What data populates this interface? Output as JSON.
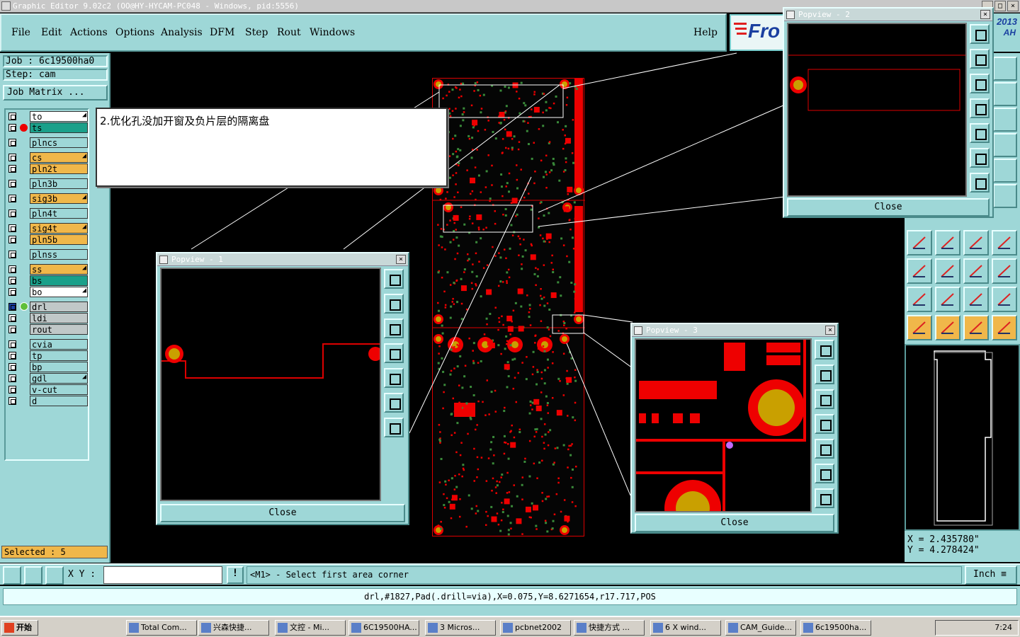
{
  "window": {
    "title": "Graphic Editor 9.02c2 (OO@HY-HYCAM-PC048 - Windows, pid:5556)"
  },
  "menu": {
    "items": [
      "File",
      "Edit",
      "Actions",
      "Options",
      "Analysis",
      "DFM",
      "Step",
      "Rout",
      "Windows"
    ],
    "help": "Help"
  },
  "logo": {
    "text": "Fro"
  },
  "corner": {
    "year": "2013",
    "sub": "AH"
  },
  "job": {
    "job_label": "Job : 6c19500ha0",
    "step_label": "Step: cam",
    "matrix_button": "Job Matrix ..."
  },
  "layers": [
    {
      "name": "to",
      "color": "#ffffff",
      "marker": true
    },
    {
      "name": "ts",
      "color": "#1aa08a",
      "dot": true
    },
    {
      "name": "plncs",
      "color": "#9ed7d7"
    },
    {
      "name": "cs",
      "color": "#f0b74a",
      "marker": true
    },
    {
      "name": "pln2t",
      "color": "#f0b74a"
    },
    {
      "name": "pln3b",
      "color": "#9ed7d7"
    },
    {
      "name": "sig3b",
      "color": "#f0b74a",
      "marker": true
    },
    {
      "name": "pln4t",
      "color": "#9ed7d7"
    },
    {
      "name": "sig4t",
      "color": "#f0b74a",
      "marker": true
    },
    {
      "name": "pln5b",
      "color": "#f0b74a"
    },
    {
      "name": "plnss",
      "color": "#9ed7d7"
    },
    {
      "name": "ss",
      "color": "#f0b74a",
      "marker": true
    },
    {
      "name": "bs",
      "color": "#1aa08a"
    },
    {
      "name": "bo",
      "color": "#ffffff",
      "marker": true
    },
    {
      "name": "drl",
      "color": "#c0c8c8",
      "active": true
    },
    {
      "name": "ldi",
      "color": "#c0c8c8"
    },
    {
      "name": "rout",
      "color": "#c0c8c8"
    },
    {
      "name": "cvia",
      "color": "#9ed7d7"
    },
    {
      "name": "tp",
      "color": "#9ed7d7"
    },
    {
      "name": "bp",
      "color": "#9ed7d7"
    },
    {
      "name": "gdl",
      "color": "#9ed7d7",
      "marker": true
    },
    {
      "name": "v-cut",
      "color": "#9ed7d7"
    },
    {
      "name": "d",
      "color": "#9ed7d7"
    }
  ],
  "selected": {
    "label": "Selected : 5"
  },
  "annotation": {
    "text": "2.优化孔没加开窗及负片层的隔离盘"
  },
  "popviews": [
    {
      "title": "Popview - 1",
      "close": "Close"
    },
    {
      "title": "Popview - 2",
      "close": "Close"
    },
    {
      "title": "Popview - 3",
      "close": "Close"
    }
  ],
  "coords": {
    "x": "X = 2.435780\"",
    "y": "Y = 4.278424\""
  },
  "bottom": {
    "xy_label": "X Y :",
    "xy_value": "",
    "message": "<M1> - Select first area corner",
    "units": "Inch",
    "excl": "!"
  },
  "status": {
    "text": "drl,#1827,Pad(.drill=via),X=0.075,Y=8.6271654,r17.717,POS"
  },
  "taskbar": {
    "start": "开始",
    "buttons": [
      "Total Com...",
      "兴森快捷...",
      "文控 - Mi...",
      "6C19500HA...",
      "3 Micros...",
      "pcbnet2002",
      "快捷方式 ...",
      "6 X wind...",
      "CAM_Guide...",
      "6c19500ha..."
    ],
    "clock": "7:24"
  }
}
